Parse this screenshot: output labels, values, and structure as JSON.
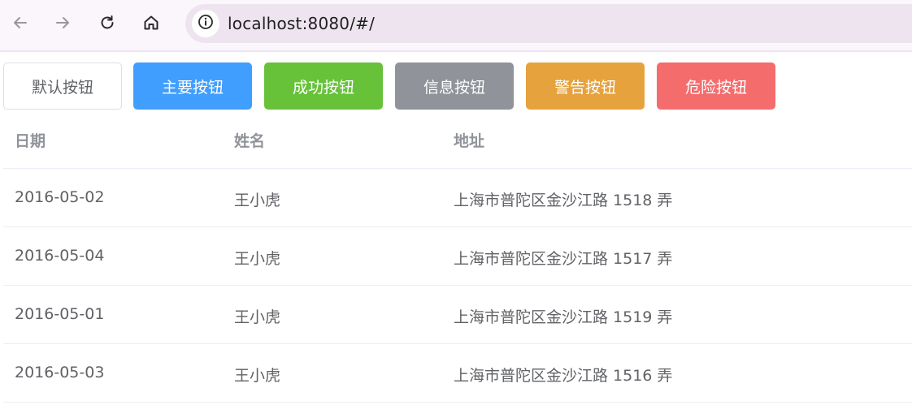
{
  "browser": {
    "url": "localhost:8080/#/"
  },
  "buttons": {
    "default": "默认按钮",
    "primary": "主要按钮",
    "success": "成功按钮",
    "info": "信息按钮",
    "warning": "警告按钮",
    "danger": "危险按钮"
  },
  "table": {
    "headers": [
      "日期",
      "姓名",
      "地址"
    ],
    "rows": [
      {
        "date": "2016-05-02",
        "name": "王小虎",
        "address": "上海市普陀区金沙江路 1518 弄"
      },
      {
        "date": "2016-05-04",
        "name": "王小虎",
        "address": "上海市普陀区金沙江路 1517 弄"
      },
      {
        "date": "2016-05-01",
        "name": "王小虎",
        "address": "上海市普陀区金沙江路 1519 弄"
      },
      {
        "date": "2016-05-03",
        "name": "王小虎",
        "address": "上海市普陀区金沙江路 1516 弄"
      }
    ]
  },
  "colors": {
    "primary": "#409eff",
    "success": "#67c23a",
    "info": "#909399",
    "warning": "#e6a23c",
    "danger": "#f56c6c"
  }
}
